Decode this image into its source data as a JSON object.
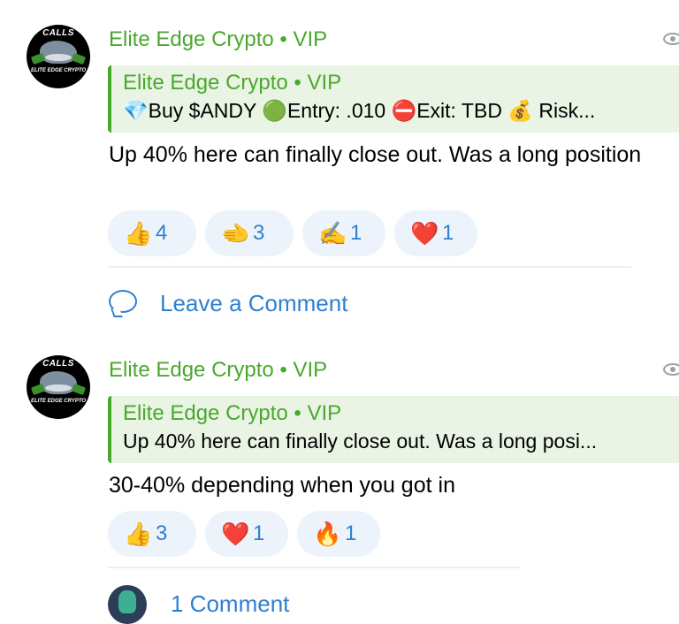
{
  "posts": [
    {
      "avatar": {
        "top_text": "CALLS",
        "brand_text": "ELITE EDGE CRYPTO"
      },
      "channel": "Elite Edge Crypto • VIP",
      "quote": {
        "name": "Elite Edge Crypto • VIP",
        "text": "💎Buy $ANDY 🟢Entry: .010 ⛔Exit: TBD 💰 Risk..."
      },
      "text": "Up 40% here can finally close out. Was a long position",
      "reactions": [
        {
          "emoji": "👍",
          "count": "4"
        },
        {
          "emoji": "🫲",
          "count": "3"
        },
        {
          "emoji": "✍️",
          "count": "1"
        },
        {
          "emoji": "❤️",
          "count": "1"
        }
      ],
      "comment_link": "Leave a Comment"
    },
    {
      "avatar": {
        "top_text": "CALLS",
        "brand_text": "ELITE EDGE CRYPTO"
      },
      "channel": "Elite Edge Crypto • VIP",
      "quote": {
        "name": "Elite Edge Crypto • VIP",
        "text": "Up 40% here can finally close out. Was a long posi..."
      },
      "text": "30-40% depending when you got in",
      "reactions": [
        {
          "emoji": "👍",
          "count": "3"
        },
        {
          "emoji": "❤️",
          "count": "1"
        },
        {
          "emoji": "🔥",
          "count": "1"
        }
      ],
      "comment_link": "1 Comment"
    }
  ],
  "colors": {
    "accent_green": "#4aa82e",
    "link_blue": "#2f7fd0",
    "quote_bg": "#eaf4e4",
    "reaction_bg": "#edf3fa"
  }
}
